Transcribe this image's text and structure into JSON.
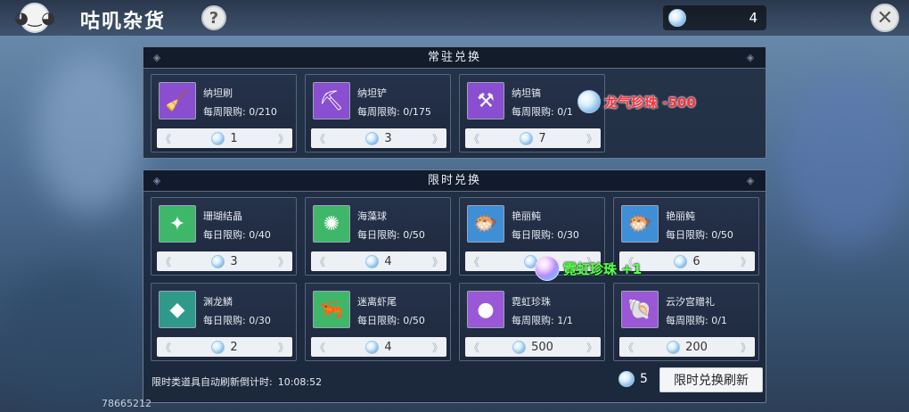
{
  "header": {
    "title": "咕叽杂货",
    "help": "?",
    "currency_value": "4",
    "close": "✕"
  },
  "permanent": {
    "title": "常驻兑换",
    "items": [
      {
        "name": "纳坦刷",
        "limit": "每周限购: 0/210",
        "price": "1",
        "icon": "broom",
        "icon_glyph": "🧹",
        "icon_bg": "#8a4fd0"
      },
      {
        "name": "纳坦铲",
        "limit": "每周限购: 0/175",
        "price": "3",
        "icon": "shovel",
        "icon_glyph": "⛏",
        "icon_bg": "#8a4fd0"
      },
      {
        "name": "纳坦镐",
        "limit": "每周限购: 0/1",
        "price": "7",
        "icon": "pickaxe",
        "icon_glyph": "⚒",
        "icon_bg": "#8a4fd0"
      }
    ]
  },
  "limited": {
    "title": "限时兑换",
    "items": [
      {
        "name": "珊瑚结晶",
        "limit": "每日限购: 0/40",
        "price": "3",
        "icon": "coral-crystal",
        "icon_glyph": "✦",
        "icon_bg": "#3fb76a"
      },
      {
        "name": "海藻球",
        "limit": "每日限购: 0/50",
        "price": "4",
        "icon": "seaweed-ball",
        "icon_glyph": "✺",
        "icon_bg": "#3fb76a"
      },
      {
        "name": "艳丽鲀",
        "limit": "每日限购: 0/30",
        "price": "",
        "icon": "puffer-fish",
        "icon_glyph": "🐡",
        "icon_bg": "#3f8fd6"
      },
      {
        "name": "艳丽鲀",
        "limit": "每日限购: 0/50",
        "price": "6",
        "icon": "puffer-fish",
        "icon_glyph": "🐡",
        "icon_bg": "#3f8fd6"
      },
      {
        "name": "渊龙鳞",
        "limit": "每日限购: 0/30",
        "price": "2",
        "icon": "dragon-scale",
        "icon_glyph": "◆",
        "icon_bg": "#2f9a8a"
      },
      {
        "name": "迷离虾尾",
        "limit": "每日限购: 0/50",
        "price": "4",
        "icon": "shrimp-tail",
        "icon_glyph": "🦐",
        "icon_bg": "#3fb76a"
      },
      {
        "name": "霓虹珍珠",
        "limit": "每周限购: 1/1",
        "price": "500",
        "icon": "neon-pearl",
        "icon_glyph": "●",
        "icon_bg": "#9a58d6"
      },
      {
        "name": "云汐宫赠礼",
        "limit": "每周限购: 0/1",
        "price": "200",
        "icon": "conch-gift",
        "icon_glyph": "🐚",
        "icon_bg": "#9a58d6"
      }
    ]
  },
  "popups": {
    "red": "龙气珍珠 -500",
    "green": "霓虹珍珠 +1"
  },
  "footer": {
    "countdown_label": "限时类道具自动刷新倒计时:",
    "countdown_time": "10:08:52",
    "refresh_cost": "5",
    "refresh_button": "限时兑换刷新",
    "player_id": "78665212"
  },
  "colors": {
    "accent": "#6c7d95",
    "red_text": "#ff2f3a",
    "green_text": "#5dff54"
  }
}
